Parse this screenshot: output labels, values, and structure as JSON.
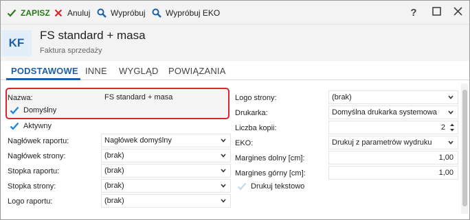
{
  "toolbar": {
    "save_label": "ZAPISZ",
    "cancel_label": "Anuluj",
    "test_label": "Wypróbuj",
    "test_eko_label": "Wypróbuj EKO",
    "help_label": "?"
  },
  "header": {
    "badge": "KF",
    "title": "FS standard + masa",
    "subtitle": "Faktura sprzedaży"
  },
  "tabs": [
    {
      "label": "PODSTAWOWE",
      "active": true
    },
    {
      "label": "INNE",
      "active": false
    },
    {
      "label": "WYGLĄD",
      "active": false
    },
    {
      "label": "POWIĄZANIA",
      "active": false
    }
  ],
  "left_form": {
    "nazwa_label": "Nazwa:",
    "nazwa_value": "FS standard + masa",
    "domyslny_label": "Domyślny",
    "domyslny_checked": true,
    "aktywny_label": "Aktywny",
    "aktywny_checked": true,
    "naglowek_raportu_label": "Nagłówek raportu:",
    "naglowek_raportu_value": "Nagłówek domyślny",
    "naglowek_strony_label": "Nagłówek strony:",
    "naglowek_strony_value": "(brak)",
    "stopka_raportu_label": "Stopka raportu:",
    "stopka_raportu_value": "(brak)",
    "stopka_strony_label": "Stopka strony:",
    "stopka_strony_value": "(brak)",
    "logo_raportu_label": "Logo raportu:",
    "logo_raportu_value": "(brak)"
  },
  "right_form": {
    "logo_strony_label": "Logo strony:",
    "logo_strony_value": "(brak)",
    "drukarka_label": "Drukarka:",
    "drukarka_value": "Domyślna drukarka systemowa",
    "liczba_kopii_label": "Liczba kopii:",
    "liczba_kopii_value": "2",
    "eko_label": "EKO:",
    "eko_value": "Drukuj z parametrów wydruku",
    "margines_dolny_label": "Margines dolny [cm]:",
    "margines_dolny_value": "1,00",
    "margines_gorny_label": "Margines górny [cm]:",
    "margines_gorny_value": "1,00",
    "drukuj_tekstowo_label": "Drukuj tekstowo",
    "drukuj_tekstowo_checked": false
  },
  "colors": {
    "accent": "#1f5fa8",
    "save_green": "#2a7a1a",
    "cancel_red": "#d9242c",
    "highlight_red": "#d9242c",
    "check_blue": "#1e88d8"
  },
  "icons": {
    "save": "check-icon",
    "cancel": "x-icon",
    "test": "magnifier-icon",
    "test_eko": "magnifier-icon",
    "help": "question-icon",
    "maximize": "maximize-icon",
    "close": "close-icon"
  }
}
